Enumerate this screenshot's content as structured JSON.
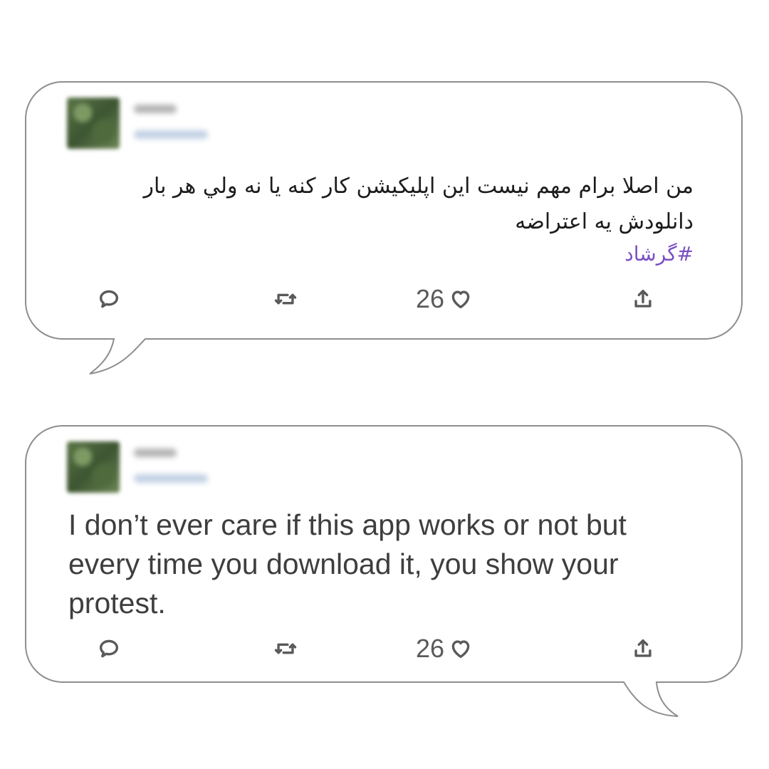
{
  "tweets": [
    {
      "text_lines": [
        "من اصلا برام مهم نیست این اپلیکیشن کار کنه یا نه ولي هر بار",
        "دانلودش یه اعتراضه"
      ],
      "hashtag": "#گرشاد",
      "like_count": "26"
    },
    {
      "text_lines": [
        "I don’t ever care if this app works or not but",
        "every time you download it, you show your",
        "protest."
      ],
      "like_count": "26"
    }
  ],
  "icons": {
    "reply": "reply-icon",
    "retweet": "retweet-icon",
    "like": "heart-icon",
    "share": "share-icon"
  }
}
